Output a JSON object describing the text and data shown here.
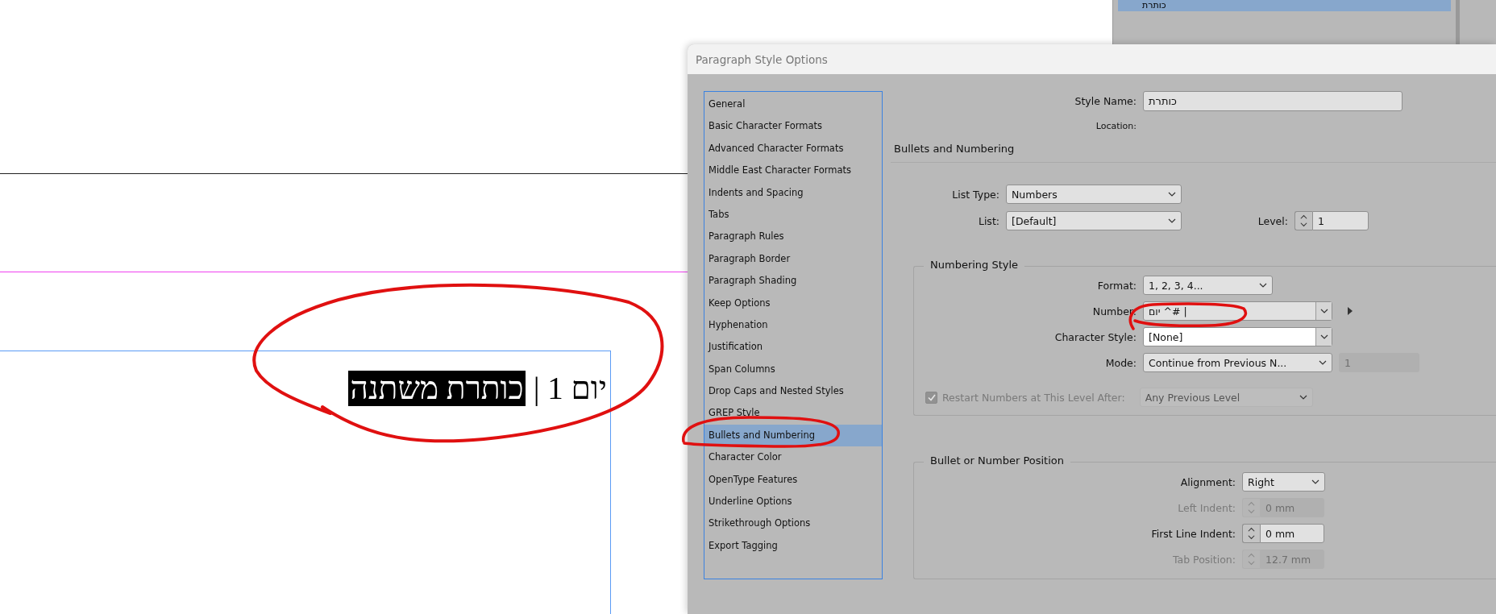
{
  "canvas": {
    "heading_number": "יום 1 |",
    "heading_selected": "כותרת משתנה"
  },
  "panel": {
    "items": [
      {
        "label": "כותרת",
        "selected": true
      }
    ]
  },
  "dialog": {
    "title": "Paragraph Style Options",
    "categories": [
      {
        "label": "General",
        "selected": false
      },
      {
        "label": "Basic Character Formats",
        "selected": false
      },
      {
        "label": "Advanced Character Formats",
        "selected": false
      },
      {
        "label": "Middle East Character Formats",
        "selected": false
      },
      {
        "label": "Indents and Spacing",
        "selected": false
      },
      {
        "label": "Tabs",
        "selected": false
      },
      {
        "label": "Paragraph Rules",
        "selected": false
      },
      {
        "label": "Paragraph Border",
        "selected": false
      },
      {
        "label": "Paragraph Shading",
        "selected": false
      },
      {
        "label": "Keep Options",
        "selected": false
      },
      {
        "label": "Hyphenation",
        "selected": false
      },
      {
        "label": "Justification",
        "selected": false
      },
      {
        "label": "Span Columns",
        "selected": false
      },
      {
        "label": "Drop Caps and Nested Styles",
        "selected": false
      },
      {
        "label": "GREP Style",
        "selected": false
      },
      {
        "label": "Bullets and Numbering",
        "selected": true
      },
      {
        "label": "Character Color",
        "selected": false
      },
      {
        "label": "OpenType Features",
        "selected": false
      },
      {
        "label": "Underline Options",
        "selected": false
      },
      {
        "label": "Strikethrough Options",
        "selected": false
      },
      {
        "label": "Export Tagging",
        "selected": false
      }
    ],
    "style_name": {
      "label": "Style Name:",
      "value": "כותרת"
    },
    "location": {
      "label": "Location:"
    },
    "section_title": "Bullets and Numbering",
    "list_type": {
      "label": "List Type:",
      "value": "Numbers"
    },
    "list": {
      "label": "List:",
      "value": "[Default]"
    },
    "level": {
      "label": "Level:",
      "value": "1"
    },
    "numbering_style": {
      "legend": "Numbering Style",
      "rows": [
        {
          "kind": "select",
          "label": "Format:",
          "value": "1, 2, 3, 4...",
          "disabled": false
        },
        {
          "kind": "combo",
          "label": "Number:",
          "value": "יום ^# |",
          "disabled": false,
          "flyout": true
        },
        {
          "kind": "combo",
          "label": "Character Style:",
          "value": "[None]",
          "disabled": false,
          "flyout": false
        },
        {
          "kind": "select_extra",
          "label": "Mode:",
          "value": "Continue from Previous N...",
          "extra": "1",
          "disabled": false
        }
      ],
      "restart": {
        "label": "Restart Numbers at This Level After:",
        "checked": true,
        "disabled": true,
        "value": "Any Previous Level"
      }
    },
    "position": {
      "legend": "Bullet or Number Position",
      "rows": [
        {
          "kind": "select",
          "label": "Alignment:",
          "value": "Right",
          "disabled": false
        },
        {
          "kind": "spinner",
          "label": "Left Indent:",
          "value": "0 mm",
          "disabled": true
        },
        {
          "kind": "spinner",
          "label": "First Line Indent:",
          "value": "0 mm",
          "disabled": false
        },
        {
          "kind": "spinner",
          "label": "Tab Position:",
          "value": "12.7 mm",
          "disabled": true
        }
      ]
    }
  }
}
